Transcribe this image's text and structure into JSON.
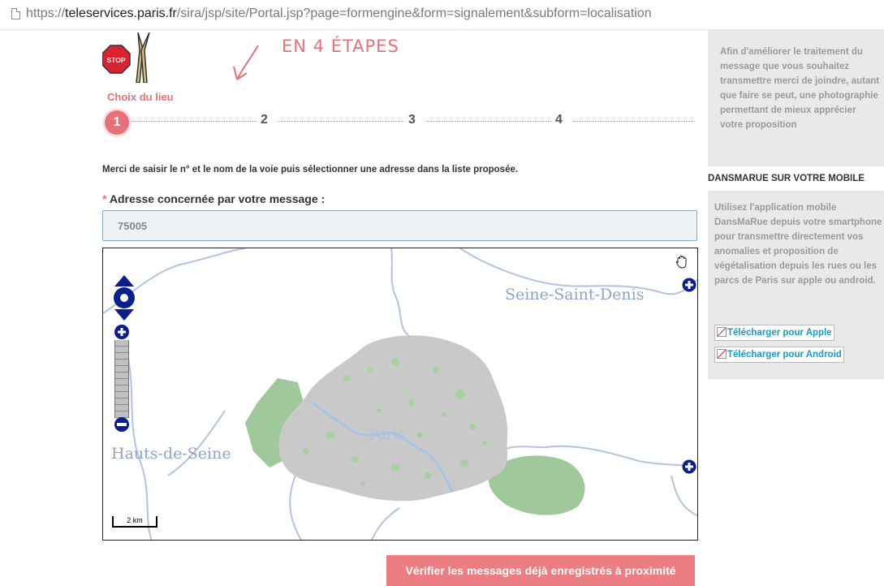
{
  "browser": {
    "url_prefix": "https://",
    "url_host": "teleservices.paris.fr",
    "url_path": "/sira/jsp/site/Portal.jsp?page=formengine&form=signalement&subform=localisation"
  },
  "header": {
    "logo_text": "STOP",
    "steps_note": "EN 4 ÉTAPES"
  },
  "stepper": {
    "active_label": "Choix du lieu",
    "steps": [
      "1",
      "2",
      "3",
      "4"
    ],
    "active_step": 1
  },
  "form": {
    "instruction": "Merci de saisir le n° et le nom de la voie puis sélectionner une adresse dans la liste proposée.",
    "required_mark": "*",
    "address_label": "Adresse concernée par votre message :",
    "address_value": "75005"
  },
  "map": {
    "labels": {
      "seine_saint_denis": "Seine-Saint-Denis",
      "hauts_de_seine": "Hauts-de-Seine",
      "paris": "Paris"
    },
    "scale": "2 km",
    "colors": {
      "city": "#c9c9c9",
      "parks": "#9fc99a",
      "river": "#a9c3e6",
      "controls": "#0a1f8a"
    }
  },
  "sidebar": {
    "info_text": "Afin d'améliorer le traitement du message que vous souhaitez transmettre merci de joindre, autant que faire se peut, une photographie permettant de mieux apprécier votre proposition",
    "mobile_title": "DANSMARUE SUR VOTRE MOBILE",
    "mobile_text": "Utilisez l'application mobile DansMaRue depuis votre smartphone pour transmettre directement vos anomalies et proposition de végétalisation depuis les rues ou les parcs de Paris sur apple ou android.",
    "download_apple": "Télécharger pour Apple",
    "download_android": "Télécharger pour Android"
  },
  "actions": {
    "verify_label": "Vérifier les messages déjà enregistrés à proximité"
  },
  "colors": {
    "accent": "#e8707a",
    "button": "#ec7e82",
    "sidebar_bg": "#e9e9e9"
  }
}
